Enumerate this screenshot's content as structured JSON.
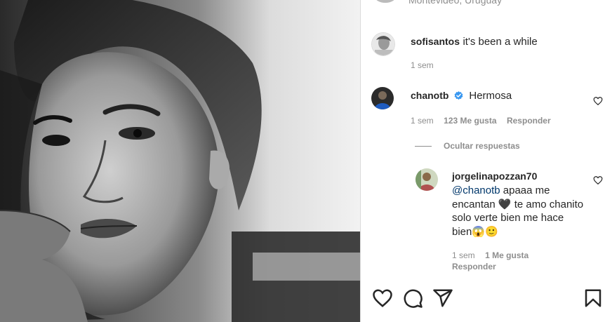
{
  "header": {
    "location": "Montevideo, Uruguay"
  },
  "comments": [
    {
      "username": "sofisantos",
      "text": "it's been a while",
      "time": "1 sem"
    },
    {
      "username": "chanotb",
      "verified": true,
      "text": "Hermosa",
      "time": "1 sem",
      "likes": "123 Me gusta",
      "reply_label": "Responder",
      "toggle_replies": "Ocultar respuestas"
    }
  ],
  "reply": {
    "username": "jorgelinapozzan70",
    "mention": "@chanotb",
    "line1_rest": " apaaa me",
    "line2": "encantan 🖤 te amo chanito",
    "line3": "solo verte bien me hace",
    "line4": "bien😱🙂",
    "time": "1 sem",
    "likes": "1 Me gusta",
    "reply_label": "Responder"
  },
  "icons": {
    "like": "heart-icon",
    "comment": "comment-icon",
    "share": "paper-plane-icon",
    "save": "bookmark-icon",
    "verified": "verified-badge-icon"
  },
  "colors": {
    "verified": "#3897f0",
    "text": "#262626",
    "muted": "#8e8e8e",
    "mention": "#00376b"
  }
}
